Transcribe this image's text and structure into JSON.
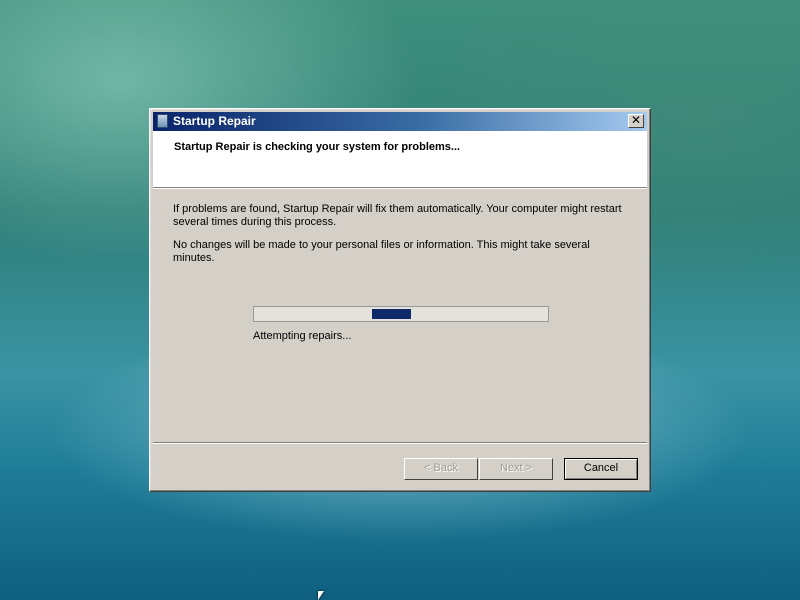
{
  "window": {
    "title": "Startup Repair",
    "close_glyph": "✕",
    "icon": "startup-repair-icon"
  },
  "header": {
    "heading": "Startup Repair is checking your system for problems..."
  },
  "body": {
    "paragraph1": "If problems are found, Startup Repair will fix them automatically. Your computer might restart several times during this process.",
    "paragraph2": "No changes will be made to your personal files or information. This might take several minutes."
  },
  "progress": {
    "status": "Attempting repairs...",
    "style": "marquee",
    "fill_color": "#0e2a6b"
  },
  "buttons": {
    "back": "< Back",
    "next": "Next >",
    "cancel": "Cancel"
  },
  "colors": {
    "dialog_face": "#d4d0c8",
    "title_start": "#0a246a",
    "title_end": "#a6caf0"
  }
}
